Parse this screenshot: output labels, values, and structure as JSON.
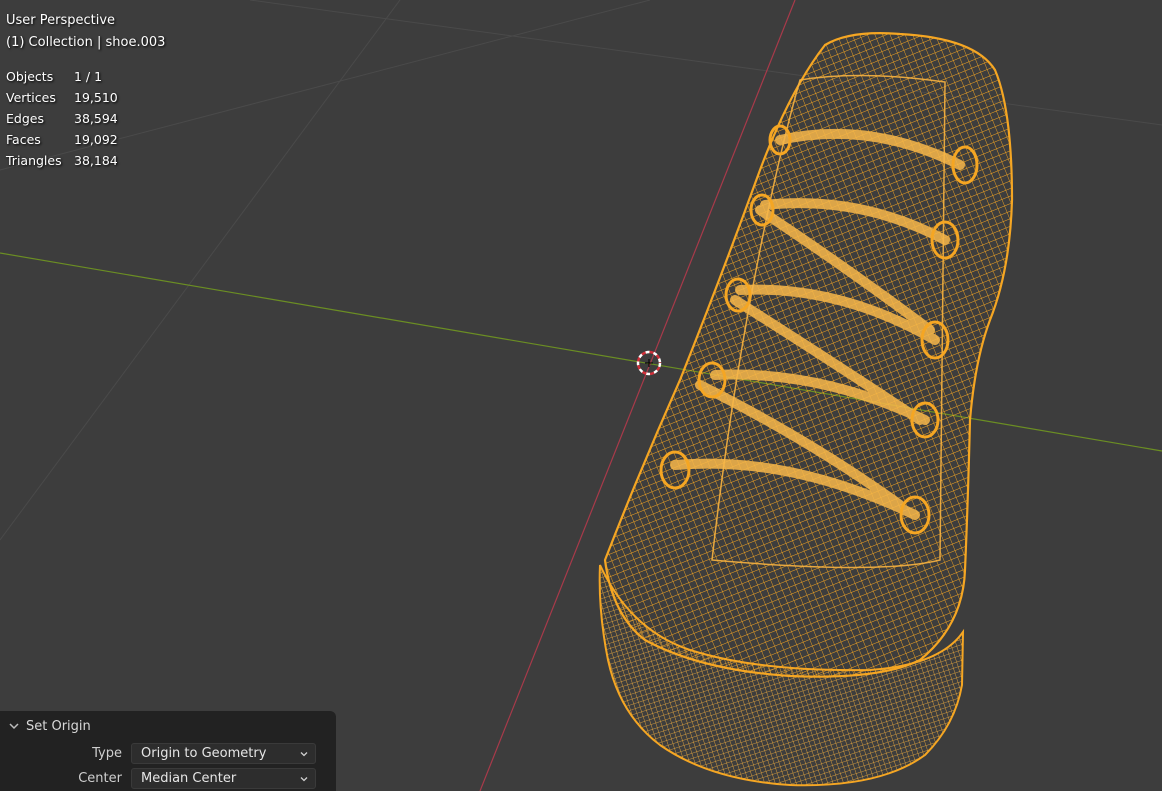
{
  "viewport": {
    "view_name": "User Perspective",
    "collection_line": "(1) Collection | shoe.003",
    "stats": [
      {
        "label": "Objects",
        "value": "1 / 1"
      },
      {
        "label": "Vertices",
        "value": "19,510"
      },
      {
        "label": "Edges",
        "value": "38,594"
      },
      {
        "label": "Faces",
        "value": "19,092"
      },
      {
        "label": "Triangles",
        "value": "38,184"
      }
    ],
    "colors": {
      "background": "#3d3d3d",
      "grid": "#4a4a4a",
      "x_axis": "#a83a4a",
      "y_axis": "#6b8e23",
      "selection_wire": "#f5a623"
    },
    "icons": {
      "cursor": "3d-cursor-icon"
    }
  },
  "operator_panel": {
    "title": "Set Origin",
    "type_label": "Type",
    "type_value": "Origin to Geometry",
    "center_label": "Center",
    "center_value": "Median Center"
  }
}
